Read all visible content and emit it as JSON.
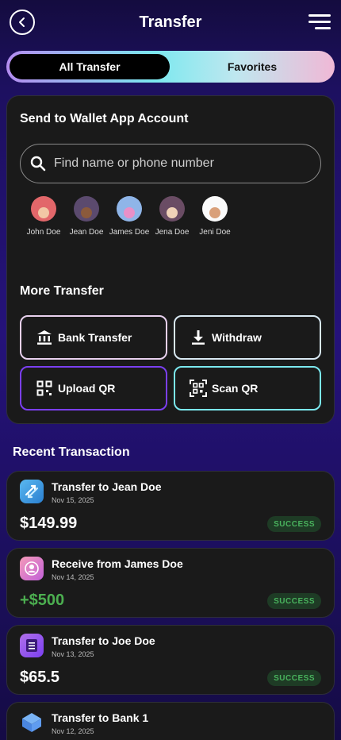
{
  "header": {
    "title": "Transfer"
  },
  "tabs": [
    {
      "label": "All Transfer",
      "active": true
    },
    {
      "label": "Favorites",
      "active": false
    }
  ],
  "send_section": {
    "title": "Send to Wallet App Account",
    "search_placeholder": "Find name or phone number",
    "contacts": [
      {
        "name": "John Doe",
        "bg": "#e2676a"
      },
      {
        "name": "Jean Doe",
        "bg": "#5b4a6e"
      },
      {
        "name": "James Doe",
        "bg": "#8fb5e8"
      },
      {
        "name": "Jena Doe",
        "bg": "#6a4c64"
      },
      {
        "name": "Jeni Doe",
        "bg": "#fafafa"
      }
    ]
  },
  "more_section": {
    "title": "More Transfer",
    "buttons": [
      {
        "label": "Bank Transfer",
        "icon": "bank-icon"
      },
      {
        "label": "Withdraw",
        "icon": "download-icon"
      },
      {
        "label": "Upload QR",
        "icon": "qr-code-icon"
      },
      {
        "label": "Scan QR",
        "icon": "qr-scan-icon"
      }
    ]
  },
  "recent": {
    "title": "Recent Transaction",
    "transactions": [
      {
        "title": "Transfer to Jean Doe",
        "date": "Nov 15, 2025",
        "amount": "$149.99",
        "status": "SUCCESS",
        "amount_color": "#ffffff",
        "icon": "transfer-icon"
      },
      {
        "title": "Receive from James Doe",
        "date": "Nov 14, 2025",
        "amount": "+$500",
        "status": "SUCCESS",
        "amount_color": "#4caf50",
        "icon": "receive-user-icon"
      },
      {
        "title": "Transfer to Joe Doe",
        "date": "Nov 13, 2025",
        "amount": "$65.5",
        "status": "SUCCESS",
        "amount_color": "#ffffff",
        "icon": "list-doc-icon"
      },
      {
        "title": "Transfer to Bank 1",
        "date": "Nov 12, 2025",
        "amount": "",
        "status": "",
        "amount_color": "#ffffff",
        "icon": "bank-3d-icon"
      }
    ]
  },
  "colors": {
    "success_bg": "#1e3b25",
    "success_text": "#49b25d",
    "accent_cyan": "#7be8ef",
    "accent_purple": "#7b3ff2"
  }
}
